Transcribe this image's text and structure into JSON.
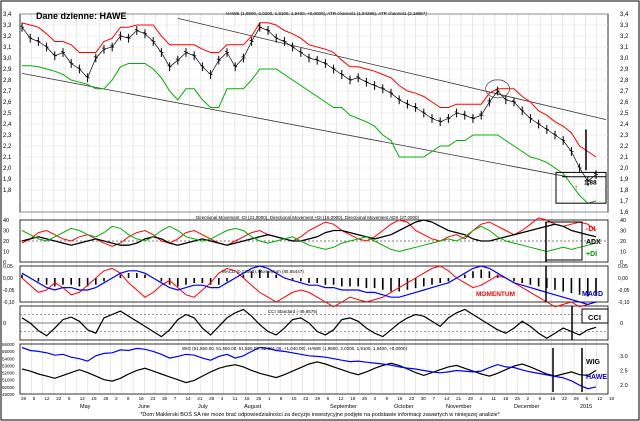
{
  "chart_data": [
    {
      "type": "line",
      "panel": "price",
      "title": "Dane dzienne: HAWE",
      "header": "HAWE (1,9500, 2,0200, 1,9100, 1,9400, +0,0000), ATR channel1 (1,94286), ATR channel1 (2,18957)",
      "ylim": [
        1.6,
        3.4
      ],
      "ticks": [
        "3,4",
        "3,3",
        "3,2",
        "3,1",
        "3,0",
        "2,9",
        "2,8",
        "2,7",
        "2,6",
        "2,5",
        "2,4",
        "2,3",
        "2,2",
        "2,1",
        "2,0",
        "1,9",
        "1,8",
        "1,7",
        "1,6"
      ],
      "left_ticks": [
        "3,4",
        "3,3",
        "3,2",
        "3,1",
        "3,0",
        "2,9",
        "2,8",
        "2,7",
        "2,6",
        "2,5",
        "2,4",
        "2,3",
        "2,2",
        "2,1",
        "2,0",
        "1,9",
        "1,8"
      ],
      "annotation": "1,88",
      "colors": {
        "price": "#000000",
        "atr_upper": "#ff0000",
        "atr_lower": "#00b000",
        "trendline": "#000000"
      },
      "series": [
        {
          "name": "HAWE",
          "values": [
            3.28,
            3.18,
            3.15,
            3.1,
            3.02,
            3.05,
            2.95,
            2.9,
            2.82,
            3.0,
            3.08,
            3.1,
            3.2,
            3.18,
            3.25,
            3.22,
            3.15,
            3.05,
            2.92,
            2.98,
            3.05,
            3.02,
            2.92,
            2.85,
            2.98,
            3.05,
            2.92,
            3.0,
            3.15,
            3.28,
            3.25,
            3.18,
            3.15,
            3.1,
            3.05,
            3.0,
            2.98,
            2.95,
            2.9,
            2.85,
            2.8,
            2.82,
            2.78,
            2.75,
            2.72,
            2.68,
            2.62,
            2.58,
            2.55,
            2.5,
            2.45,
            2.42,
            2.45,
            2.5,
            2.48,
            2.45,
            2.48,
            2.6,
            2.7,
            2.62,
            2.6,
            2.52,
            2.45,
            2.4,
            2.35,
            2.3,
            2.25,
            2.15,
            2.0,
            1.88,
            1.94
          ]
        },
        {
          "name": "ATR channel upper",
          "values": [
            3.32,
            3.3,
            3.28,
            3.22,
            3.15,
            3.15,
            3.12,
            3.05,
            3.05,
            3.05,
            3.15,
            3.18,
            3.28,
            3.28,
            3.3,
            3.3,
            3.3,
            3.2,
            3.12,
            3.12,
            3.12,
            3.12,
            3.08,
            3.05,
            3.05,
            3.12,
            3.12,
            3.12,
            3.2,
            3.32,
            3.32,
            3.3,
            3.25,
            3.22,
            3.18,
            3.12,
            3.1,
            3.08,
            3.05,
            2.98,
            2.92,
            2.92,
            2.9,
            2.88,
            2.85,
            2.82,
            2.75,
            2.7,
            2.68,
            2.65,
            2.6,
            2.55,
            2.55,
            2.58,
            2.58,
            2.58,
            2.58,
            2.68,
            2.72,
            2.72,
            2.72,
            2.65,
            2.6,
            2.52,
            2.48,
            2.42,
            2.38,
            2.32,
            2.2,
            2.15,
            2.1
          ]
        },
        {
          "name": "ATR channel lower",
          "values": [
            2.93,
            2.93,
            2.92,
            2.9,
            2.88,
            2.85,
            2.8,
            2.78,
            2.76,
            2.72,
            2.72,
            2.8,
            2.92,
            2.95,
            2.95,
            2.95,
            2.9,
            2.82,
            2.7,
            2.62,
            2.72,
            2.72,
            2.62,
            2.55,
            2.55,
            2.72,
            2.72,
            2.72,
            2.8,
            2.9,
            2.9,
            2.9,
            2.85,
            2.8,
            2.75,
            2.7,
            2.65,
            2.6,
            2.55,
            2.55,
            2.48,
            2.45,
            2.42,
            2.38,
            2.3,
            2.25,
            2.1,
            2.1,
            2.1,
            2.1,
            2.15,
            2.2,
            2.2,
            2.25,
            2.25,
            2.3,
            2.3,
            2.3,
            2.3,
            2.25,
            2.2,
            2.15,
            2.1,
            2.08,
            2.05,
            2.0,
            1.95,
            1.85,
            1.75,
            1.68,
            1.7
          ]
        }
      ]
    },
    {
      "type": "line",
      "panel": "dmi",
      "header": "Directional Movement -DI (21,0000), Directional Movement +DI (16,0000), Directional Movement ADX (27,0000)",
      "ylim": [
        0,
        40
      ],
      "ticks": [
        "40",
        "30",
        "20",
        "10",
        "0"
      ],
      "legend": [
        "-DI",
        "ADX",
        "+DI"
      ],
      "colors": {
        "-DI": "#ff0000",
        "ADX": "#000000",
        "+DI": "#00b000"
      },
      "series": [
        {
          "name": "-DI",
          "values": [
            18,
            22,
            28,
            30,
            26,
            22,
            20,
            24,
            26,
            22,
            18,
            15,
            18,
            24,
            28,
            30,
            26,
            20,
            18,
            22,
            28,
            30,
            26,
            22,
            18,
            16,
            20,
            24,
            28,
            30,
            26,
            24,
            22,
            20,
            24,
            30,
            34,
            38,
            36,
            30,
            26,
            22,
            20,
            24,
            30,
            36,
            40,
            38,
            30,
            26,
            22,
            20,
            24,
            26,
            22,
            30,
            36,
            38,
            34,
            30,
            26,
            30,
            36,
            42,
            40,
            36,
            34,
            36,
            38,
            36,
            30
          ]
        },
        {
          "name": "ADX",
          "values": [
            20,
            22,
            24,
            22,
            20,
            18,
            16,
            18,
            20,
            22,
            20,
            18,
            16,
            16,
            18,
            22,
            24,
            22,
            18,
            16,
            18,
            20,
            22,
            20,
            18,
            16,
            18,
            20,
            22,
            24,
            26,
            24,
            22,
            20,
            20,
            22,
            24,
            28,
            30,
            30,
            28,
            26,
            24,
            22,
            24,
            26,
            30,
            34,
            38,
            40,
            38,
            34,
            30,
            28,
            26,
            22,
            20,
            20,
            22,
            24,
            26,
            28,
            30,
            32,
            34,
            36,
            34,
            30,
            28,
            26,
            24
          ]
        },
        {
          "name": "+DI",
          "values": [
            30,
            26,
            22,
            20,
            24,
            28,
            32,
            30,
            26,
            24,
            28,
            34,
            32,
            26,
            22,
            20,
            24,
            30,
            34,
            30,
            24,
            22,
            20,
            22,
            26,
            30,
            32,
            30,
            24,
            20,
            18,
            20,
            22,
            24,
            20,
            16,
            14,
            12,
            14,
            18,
            20,
            22,
            24,
            20,
            16,
            12,
            10,
            12,
            14,
            16,
            18,
            20,
            22,
            20,
            24,
            30,
            34,
            30,
            24,
            20,
            18,
            16,
            14,
            12,
            10,
            12,
            14,
            12,
            14,
            16,
            18
          ]
        }
      ]
    },
    {
      "type": "line",
      "panel": "macd",
      "header": "MACD (0,12563), Momentum (85,55447)",
      "ylim": [
        -0.1,
        0.05
      ],
      "ticks": [
        "0,05",
        "0,00",
        "-0,05",
        "-0,10"
      ],
      "labels": [
        "MOMENTUM",
        "MACD"
      ],
      "colors": {
        "MACD": "#0000ff",
        "Momentum": "#ff0000"
      },
      "series": [
        {
          "name": "MACD",
          "values": [
            0.02,
            0.0,
            -0.02,
            -0.04,
            -0.05,
            -0.04,
            -0.04,
            -0.05,
            -0.05,
            -0.04,
            -0.02,
            0.0,
            0.02,
            0.03,
            0.03,
            0.02,
            0.0,
            -0.02,
            -0.04,
            -0.05,
            -0.04,
            -0.03,
            -0.03,
            -0.04,
            -0.04,
            -0.02,
            0.0,
            0.02,
            0.04,
            0.05,
            0.04,
            0.02,
            0.0,
            -0.01,
            -0.02,
            -0.03,
            -0.03,
            -0.04,
            -0.04,
            -0.05,
            -0.05,
            -0.05,
            -0.06,
            -0.06,
            -0.07,
            -0.08,
            -0.08,
            -0.07,
            -0.06,
            -0.05,
            -0.04,
            -0.03,
            -0.02,
            0.0,
            0.02,
            0.04,
            0.05,
            0.04,
            0.02,
            0.0,
            -0.02,
            -0.03,
            -0.04,
            -0.05,
            -0.06,
            -0.07,
            -0.08,
            -0.09,
            -0.1,
            -0.11,
            -0.1
          ]
        },
        {
          "name": "Momentum",
          "values": [
            0.0,
            -0.03,
            -0.06,
            -0.05,
            -0.02,
            -0.04,
            -0.07,
            -0.06,
            -0.03,
            0.0,
            0.03,
            0.04,
            0.02,
            -0.02,
            -0.05,
            -0.08,
            -0.06,
            -0.03,
            -0.01,
            -0.04,
            -0.07,
            -0.08,
            -0.05,
            -0.02,
            0.02,
            0.04,
            0.03,
            0.0,
            -0.03,
            -0.06,
            -0.08,
            -0.1,
            -0.08,
            -0.06,
            -0.05,
            -0.06,
            -0.08,
            -0.1,
            -0.12,
            -0.1,
            -0.08,
            -0.09,
            -0.1,
            -0.09,
            -0.08,
            -0.06,
            -0.04,
            -0.02,
            0.0,
            0.02,
            0.04,
            0.05,
            0.03,
            0.0,
            -0.02,
            -0.04,
            -0.03,
            -0.01,
            0.01,
            0.0,
            -0.02,
            -0.04,
            -0.06,
            -0.08,
            -0.1,
            -0.12,
            -0.11,
            -0.1,
            -0.12,
            -0.11,
            -0.1
          ]
        }
      ]
    },
    {
      "type": "line",
      "panel": "cci",
      "header": "CCI Standard (-49,8575)",
      "ticks": [
        "0"
      ],
      "labels": [
        "CCI"
      ],
      "colors": {
        "CCI": "#000000"
      },
      "series": [
        {
          "name": "CCI",
          "values": [
            60,
            0,
            -90,
            -150,
            -60,
            40,
            70,
            20,
            -80,
            -120,
            60,
            100,
            140,
            80,
            20,
            -40,
            -100,
            -160,
            -80,
            40,
            100,
            60,
            -60,
            -140,
            -40,
            60,
            120,
            160,
            80,
            -20,
            -100,
            -140,
            -60,
            40,
            60,
            0,
            -100,
            -140,
            -80,
            40,
            60,
            20,
            -60,
            -120,
            -160,
            -80,
            0,
            60,
            100,
            80,
            20,
            -40,
            60,
            120,
            160,
            100,
            40,
            -20,
            -80,
            -120,
            -60,
            20,
            -40,
            -120,
            -180,
            -120,
            -60,
            -100,
            -140,
            -80,
            -50
          ]
        }
      ]
    },
    {
      "type": "line",
      "panel": "wig",
      "header": "WIG (51,550.00, 51,550.00, 51,550.00, 52,291.00, +1,040.00), HAWE (1,9500, 2,0200, 1,9100, 1,9400, +0,0000)",
      "ylim": [
        49000,
        56000
      ],
      "left_ticks": [
        "56000",
        "55000",
        "54000",
        "53000",
        "52000",
        "51000",
        "50000",
        "49000"
      ],
      "right_ticks": [
        "3.0",
        "2.5",
        "2.0"
      ],
      "labels": [
        "WIG",
        "HAWE"
      ],
      "colors": {
        "WIG": "#000000",
        "HAWE": "#0000ff"
      },
      "series": [
        {
          "name": "WIG",
          "values": [
            52500,
            52200,
            51800,
            51500,
            51200,
            51600,
            52000,
            52400,
            52000,
            51500,
            51000,
            50800,
            51200,
            51800,
            52300,
            52600,
            52200,
            51800,
            51400,
            51000,
            50600,
            50900,
            51500,
            52100,
            52600,
            52900,
            53100,
            52800,
            52300,
            51900,
            51600,
            51300,
            51700,
            52200,
            52700,
            53200,
            53500,
            53200,
            52800,
            52400,
            52000,
            51700,
            52100,
            52600,
            53000,
            53300,
            53000,
            52500,
            52000,
            51600,
            52000,
            52400,
            52800,
            53000,
            52600,
            52200,
            51800,
            51500,
            51900,
            52400,
            52900,
            53200,
            52800,
            52300,
            51800,
            51500,
            51800,
            52100,
            51700,
            51600,
            52291
          ]
        },
        {
          "name": "HAWE",
          "values": [
            3.28,
            3.18,
            3.15,
            3.1,
            3.02,
            3.05,
            2.95,
            2.9,
            2.82,
            3.0,
            3.08,
            3.1,
            3.2,
            3.18,
            3.25,
            3.22,
            3.15,
            3.05,
            2.92,
            2.98,
            3.05,
            3.02,
            2.92,
            2.85,
            2.98,
            3.05,
            2.92,
            3.0,
            3.15,
            3.28,
            3.25,
            3.18,
            3.15,
            3.1,
            3.05,
            3.0,
            2.98,
            2.95,
            2.9,
            2.85,
            2.8,
            2.82,
            2.78,
            2.75,
            2.72,
            2.68,
            2.62,
            2.58,
            2.55,
            2.5,
            2.45,
            2.42,
            2.45,
            2.5,
            2.48,
            2.45,
            2.48,
            2.6,
            2.7,
            2.62,
            2.6,
            2.52,
            2.45,
            2.4,
            2.35,
            2.3,
            2.25,
            2.15,
            2.0,
            1.88,
            1.94
          ]
        }
      ]
    }
  ],
  "x_axis": {
    "months": [
      "May",
      "June",
      "July",
      "August",
      "September",
      "October",
      "November",
      "December",
      "2015"
    ],
    "days_line": [
      "28",
      "5",
      "12",
      "22",
      "5",
      "12",
      "19",
      "26",
      "2",
      "9",
      "16",
      "23",
      "30",
      "7",
      "14",
      "21",
      "28",
      "4",
      "11",
      "18",
      "25",
      "1",
      "8",
      "15",
      "22",
      "29",
      "5",
      "12",
      "19",
      "26",
      "2",
      "9",
      "16",
      "23",
      "30",
      "7",
      "14",
      "21",
      "28",
      "4",
      "11",
      "18",
      "25",
      "2",
      "9",
      "16",
      "22",
      "29",
      "5",
      "12",
      "19"
    ]
  },
  "footer": "*Dom Maklerski BOŚ SA nie może brać odpowiedzialności za decyzje inwestycyjne podjęte na podstawie informacji zawartych w niniejszej analizie*"
}
